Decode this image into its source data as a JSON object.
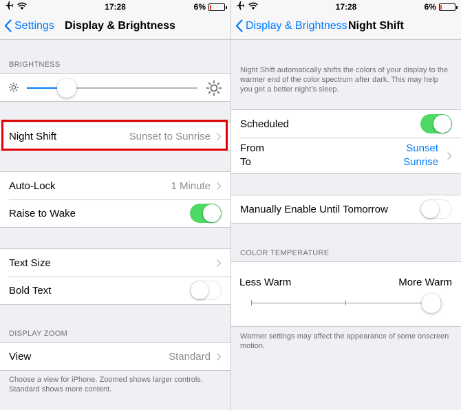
{
  "status": {
    "time": "17:28",
    "battery": "6%",
    "battery_color": "#ff3b30"
  },
  "left": {
    "nav": {
      "back_label": "Settings",
      "title": "Display & Brightness"
    },
    "brightness": {
      "header": "BRIGHTNESS",
      "level": 0.2,
      "low_icon": "sun-small-icon",
      "high_icon": "sun-large-icon"
    },
    "night_shift": {
      "label": "Night Shift",
      "value": "Sunset to Sunrise"
    },
    "auto_lock": {
      "label": "Auto-Lock",
      "value": "1 Minute"
    },
    "raise_to_wake": {
      "label": "Raise to Wake",
      "on": true
    },
    "text_size": {
      "label": "Text Size"
    },
    "bold_text": {
      "label": "Bold Text",
      "on": false
    },
    "display_zoom": {
      "header": "DISPLAY ZOOM",
      "label": "View",
      "value": "Standard",
      "footer": "Choose a view for iPhone. Zoomed shows larger controls. Standard shows more content."
    }
  },
  "right": {
    "nav": {
      "back_label": "Display & Brightness",
      "title": "Night Shift"
    },
    "intro": "Night Shift automatically shifts the colors of your display to the warmer end of the color spectrum after dark. This may help you get a better night’s sleep.",
    "scheduled": {
      "label": "Scheduled",
      "on": true
    },
    "schedule": {
      "from_label": "From",
      "to_label": "To",
      "from_value": "Sunset",
      "to_value": "Sunrise"
    },
    "manual": {
      "label": "Manually Enable Until Tomorrow",
      "on": false
    },
    "color_temperature": {
      "header": "COLOR TEMPERATURE",
      "less_label": "Less Warm",
      "more_label": "More Warm",
      "level": 1.0,
      "footer": "Warmer settings may affect the appearance of some onscreen motion."
    }
  },
  "colors": {
    "accent": "#007aff",
    "switch_on": "#4cd964",
    "highlight": "#e00000"
  }
}
